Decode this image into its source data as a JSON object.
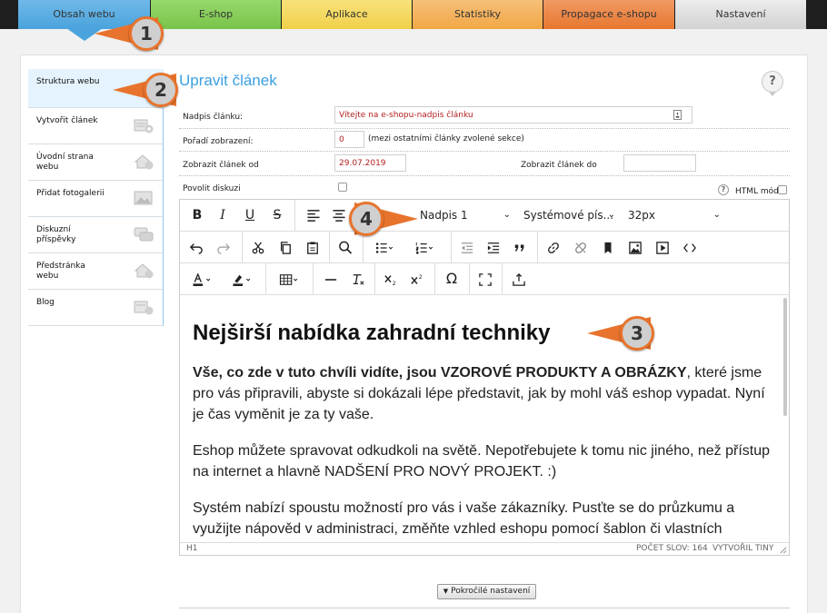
{
  "tabs": [
    {
      "label": "Obsah webu",
      "color": "#4aa3dc"
    },
    {
      "label": "E-shop",
      "color": "#78c44a"
    },
    {
      "label": "Aplikace",
      "color": "#f1d04a"
    },
    {
      "label": "Statistiky",
      "color": "#f2a745"
    },
    {
      "label": "Propagace e-shopu",
      "color": "#e8762f"
    },
    {
      "label": "Nastavení",
      "color": "#d7d7d7"
    }
  ],
  "callouts": [
    "1",
    "2",
    "3",
    "4"
  ],
  "sidebar": {
    "items": [
      {
        "label": "Struktura webu",
        "icon": "structure-icon"
      },
      {
        "label": "Vytvořit článek",
        "icon": "create-article-icon"
      },
      {
        "label": "Úvodní strana webu",
        "icon": "homepage-icon"
      },
      {
        "label": "Přidat fotogalerii",
        "icon": "gallery-icon"
      },
      {
        "label": "Diskuzní příspěvky",
        "icon": "discussion-icon"
      },
      {
        "label": "Předstránka webu",
        "icon": "prepage-icon"
      },
      {
        "label": "Blog",
        "icon": "blog-icon"
      }
    ]
  },
  "page": {
    "title": "Upravit článek",
    "help": "?"
  },
  "form": {
    "title_label": "Nadpis článku:",
    "title_value": "Vítejte na e-shopu-nadpis článku",
    "order_label": "Pořadí zobrazení:",
    "order_value": "0",
    "order_note": "(mezi ostatními články zvolené sekce)",
    "show_from_label": "Zobrazit článek od",
    "show_from_value": "29.07.2019",
    "show_to_label": "Zobrazit článek do",
    "show_to_value": "",
    "discussion_label": "Povolit diskuzi",
    "html_mode_label": "HTML mód",
    "help": "?"
  },
  "toolbar": {
    "block_format": "Nadpis 1",
    "font_family": "Systémové pís...",
    "font_size": "32px",
    "bold": "B",
    "italic": "I",
    "underline": "U",
    "strike": "S",
    "omega": "Ω"
  },
  "content": {
    "heading": "Nejširší nabídka zahradní techniky",
    "p1_bold": "Vše, co zde v tuto chvíli vidíte, jsou VZOROVÉ PRODUKTY A OBRÁZKY",
    "p1_rest": ", které jsme pro vás připravili, abyste si dokázali lépe představit, jak by mohl váš eshop vypadat. Nyní je čas vyměnit je za ty vaše.",
    "p2": "Eshop můžete spravovat odkudkoli na světě. Nepotřebujete k tomu nic jiného, než přístup na internet a hlavně NADŠENÍ PRO NOVÝ PROJEKT. :)",
    "p3": "Systém nabízí spoustu možností pro vás i vaše zákazníky. Pusťte se do průzkumu a využijte nápověd v administraci, změňte vzhled eshopu pomocí šablon či vlastních"
  },
  "statusbar": {
    "element_path": "H1",
    "word_count": "POČET SLOV: 164",
    "brand": "VYTVOŘIL TINY"
  },
  "advanced_button": "Pokročilé nastavení"
}
